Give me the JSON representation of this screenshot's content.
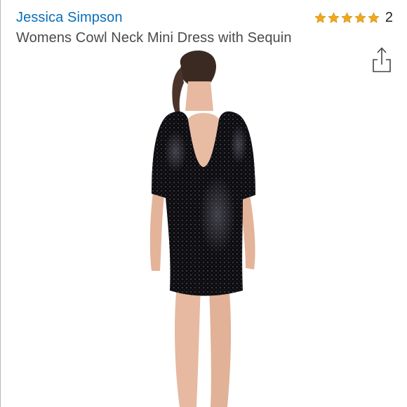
{
  "product": {
    "brand": "Jessica Simpson",
    "title": "Womens Cowl Neck Mini Dress with Sequin"
  },
  "rating": {
    "stars": 5,
    "max_stars": 5,
    "review_count": "2",
    "star_color": "#f0a81c"
  },
  "colors": {
    "brand_link": "#0a6fb8",
    "title_text": "#4a4a4a",
    "dress": "#0d0d10"
  },
  "icons": {
    "share": "share-icon",
    "star": "star-icon"
  }
}
